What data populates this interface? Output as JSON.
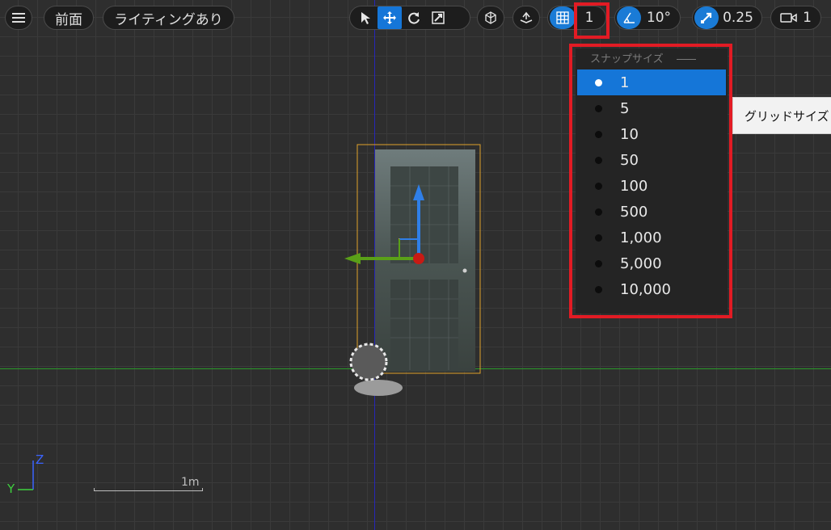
{
  "toolbar": {
    "menu_icon": "hamburger-icon",
    "view_label": "前面",
    "lighting_label": "ライティングあり",
    "grid_snap_value": "1",
    "rotation_snap_value": "10°",
    "scale_snap_value": "0.25",
    "camera_speed_value": "1"
  },
  "snap_menu": {
    "header": "スナップサイズ",
    "items": [
      "1",
      "5",
      "10",
      "50",
      "100",
      "500",
      "1,000",
      "5,000",
      "10,000"
    ],
    "selected": "1"
  },
  "tooltip": {
    "text": "グリッドサイズ"
  },
  "viewport": {
    "scale_label": "1m",
    "axis_z": "Z",
    "axis_y": "Y"
  },
  "colors": {
    "accent": "#1576d8",
    "highlight": "#e21b24",
    "grid_line": "#3a3a3a",
    "axis_vertical": "#2626b8",
    "axis_horizontal": "#2a9a2a"
  }
}
